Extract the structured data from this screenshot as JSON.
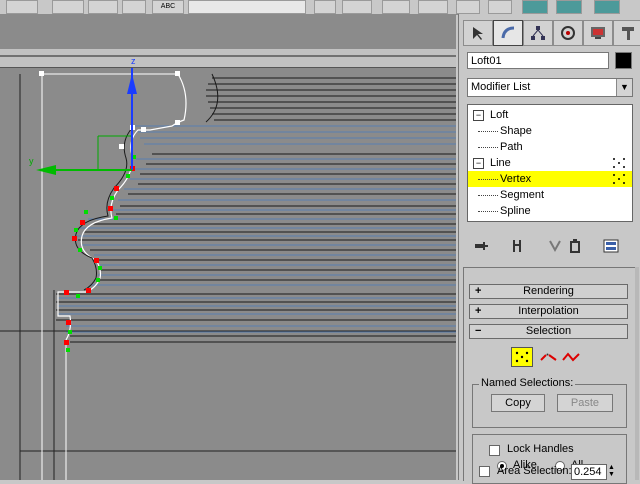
{
  "toolbar": {
    "icons": [
      "select-link-icon",
      "unlink-icon",
      "bind-space-warp-icon",
      "select-object-icon",
      "select-by-name-icon",
      "move-icon",
      "rotate-icon",
      "scale-icon",
      "snap-icon",
      "angle-snap-icon",
      "percent-snap-icon",
      "spinner-snap-icon",
      "named-selection-icon",
      "mirror-icon",
      "align-icon",
      "layer-icon",
      "curve-editor-icon",
      "schematic-icon",
      "material-editor-icon",
      "render-setup-icon",
      "quick-render-icon"
    ],
    "abc_label": "ABC"
  },
  "viewport": {
    "axis_z": "z",
    "axis_y": "y",
    "background": "#8b8b8b",
    "vertex_color": "#ff0000",
    "handle_color": "#00cc00"
  },
  "panel": {
    "tabs": [
      "create-tab-icon",
      "modify-tab-icon",
      "hierarchy-tab-icon",
      "motion-tab-icon",
      "display-tab-icon",
      "utilities-tab-icon"
    ],
    "object_name": "Loft01",
    "object_color": "#000000",
    "modifier_list": "Modifier List",
    "stack": [
      {
        "label": "Loft",
        "level": 0,
        "expand": "−"
      },
      {
        "label": "Shape",
        "level": 1
      },
      {
        "label": "Path",
        "level": 1
      },
      {
        "label": "Line",
        "level": 0,
        "expand": "−"
      },
      {
        "label": "Vertex",
        "level": 1,
        "selected": true
      },
      {
        "label": "Segment",
        "level": 1
      },
      {
        "label": "Spline",
        "level": 1
      }
    ],
    "rollouts": {
      "rendering": "Rendering",
      "interpolation": "Interpolation",
      "selection": "Selection",
      "plus": "+",
      "minus": "−"
    },
    "named_selections": {
      "title": "Named Selections:",
      "copy": "Copy",
      "paste": "Paste"
    },
    "lock_handles": "Lock Handles",
    "alike": "Alike",
    "all": "All",
    "area_selection": "Area Selection:",
    "area_value": "0.254",
    "selection_highlight": "#ffff00"
  }
}
